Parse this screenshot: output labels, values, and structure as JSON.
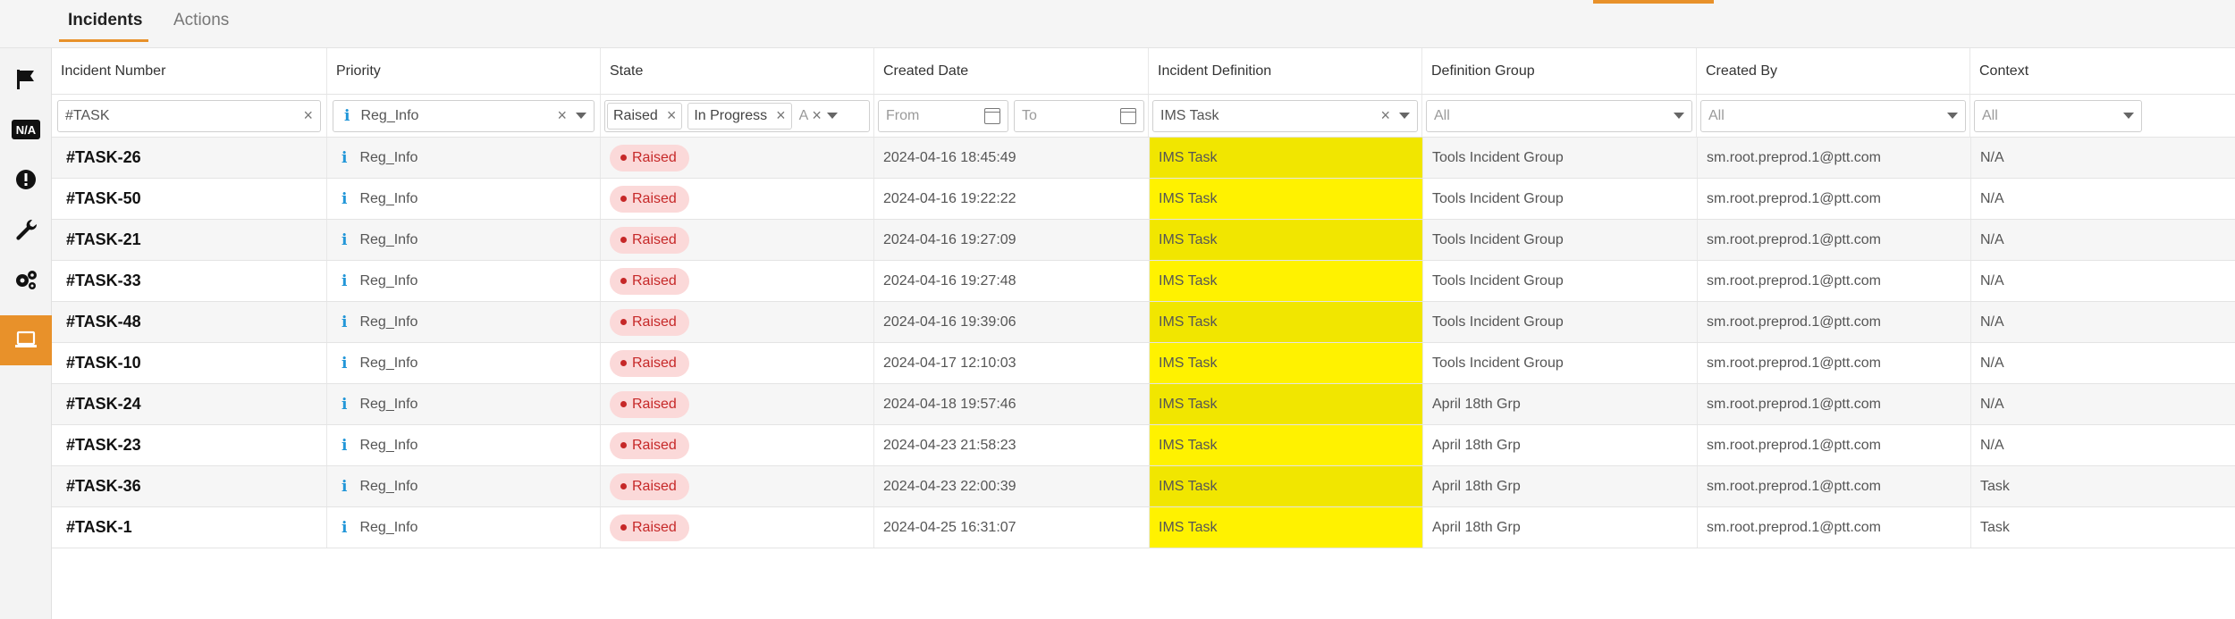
{
  "tabs": {
    "incidents": "Incidents",
    "actions": "Actions"
  },
  "sidebar": {
    "icons": [
      "flag-icon",
      "na-icon",
      "alert-icon",
      "wrench-icon",
      "gears-icon",
      "laptop-icon"
    ],
    "na_label": "N/A"
  },
  "columns": [
    "Incident Number",
    "Priority",
    "State",
    "Created Date",
    "Incident Definition",
    "Definition Group",
    "Created By",
    "Context"
  ],
  "filters": {
    "incident_number": "#TASK",
    "priority": "Reg_Info",
    "state_chips": [
      "Raised",
      "In Progress",
      "A"
    ],
    "created_from_placeholder": "From",
    "created_to_placeholder": "To",
    "definition": "IMS Task",
    "group": "All",
    "created_by": "All",
    "context": "All"
  },
  "rows": [
    {
      "number": "#TASK-26",
      "priority": "Reg_Info",
      "state": "Raised",
      "created": "2024-04-16 18:45:49",
      "definition": "IMS Task",
      "group": "Tools Incident Group",
      "created_by": "sm.root.preprod.1@ptt.com",
      "context": "N/A"
    },
    {
      "number": "#TASK-50",
      "priority": "Reg_Info",
      "state": "Raised",
      "created": "2024-04-16 19:22:22",
      "definition": "IMS Task",
      "group": "Tools Incident Group",
      "created_by": "sm.root.preprod.1@ptt.com",
      "context": "N/A"
    },
    {
      "number": "#TASK-21",
      "priority": "Reg_Info",
      "state": "Raised",
      "created": "2024-04-16 19:27:09",
      "definition": "IMS Task",
      "group": "Tools Incident Group",
      "created_by": "sm.root.preprod.1@ptt.com",
      "context": "N/A"
    },
    {
      "number": "#TASK-33",
      "priority": "Reg_Info",
      "state": "Raised",
      "created": "2024-04-16 19:27:48",
      "definition": "IMS Task",
      "group": "Tools Incident Group",
      "created_by": "sm.root.preprod.1@ptt.com",
      "context": "N/A"
    },
    {
      "number": "#TASK-48",
      "priority": "Reg_Info",
      "state": "Raised",
      "created": "2024-04-16 19:39:06",
      "definition": "IMS Task",
      "group": "Tools Incident Group",
      "created_by": "sm.root.preprod.1@ptt.com",
      "context": "N/A"
    },
    {
      "number": "#TASK-10",
      "priority": "Reg_Info",
      "state": "Raised",
      "created": "2024-04-17 12:10:03",
      "definition": "IMS Task",
      "group": "Tools Incident Group",
      "created_by": "sm.root.preprod.1@ptt.com",
      "context": "N/A"
    },
    {
      "number": "#TASK-24",
      "priority": "Reg_Info",
      "state": "Raised",
      "created": "2024-04-18 19:57:46",
      "definition": "IMS Task",
      "group": "April 18th Grp",
      "created_by": "sm.root.preprod.1@ptt.com",
      "context": "N/A"
    },
    {
      "number": "#TASK-23",
      "priority": "Reg_Info",
      "state": "Raised",
      "created": "2024-04-23 21:58:23",
      "definition": "IMS Task",
      "group": "April 18th Grp",
      "created_by": "sm.root.preprod.1@ptt.com",
      "context": "N/A"
    },
    {
      "number": "#TASK-36",
      "priority": "Reg_Info",
      "state": "Raised",
      "created": "2024-04-23 22:00:39",
      "definition": "IMS Task",
      "group": "April 18th Grp",
      "created_by": "sm.root.preprod.1@ptt.com",
      "context": "Task"
    },
    {
      "number": "#TASK-1",
      "priority": "Reg_Info",
      "state": "Raised",
      "created": "2024-04-25 16:31:07",
      "definition": "IMS Task",
      "group": "April 18th Grp",
      "created_by": "sm.root.preprod.1@ptt.com",
      "context": "Task"
    }
  ],
  "colors": {
    "accent": "#e8912a",
    "highlight": "#fff200",
    "raised_bg": "#fbd9d9",
    "raised_text": "#c62828",
    "info_icon": "#2196d8"
  }
}
